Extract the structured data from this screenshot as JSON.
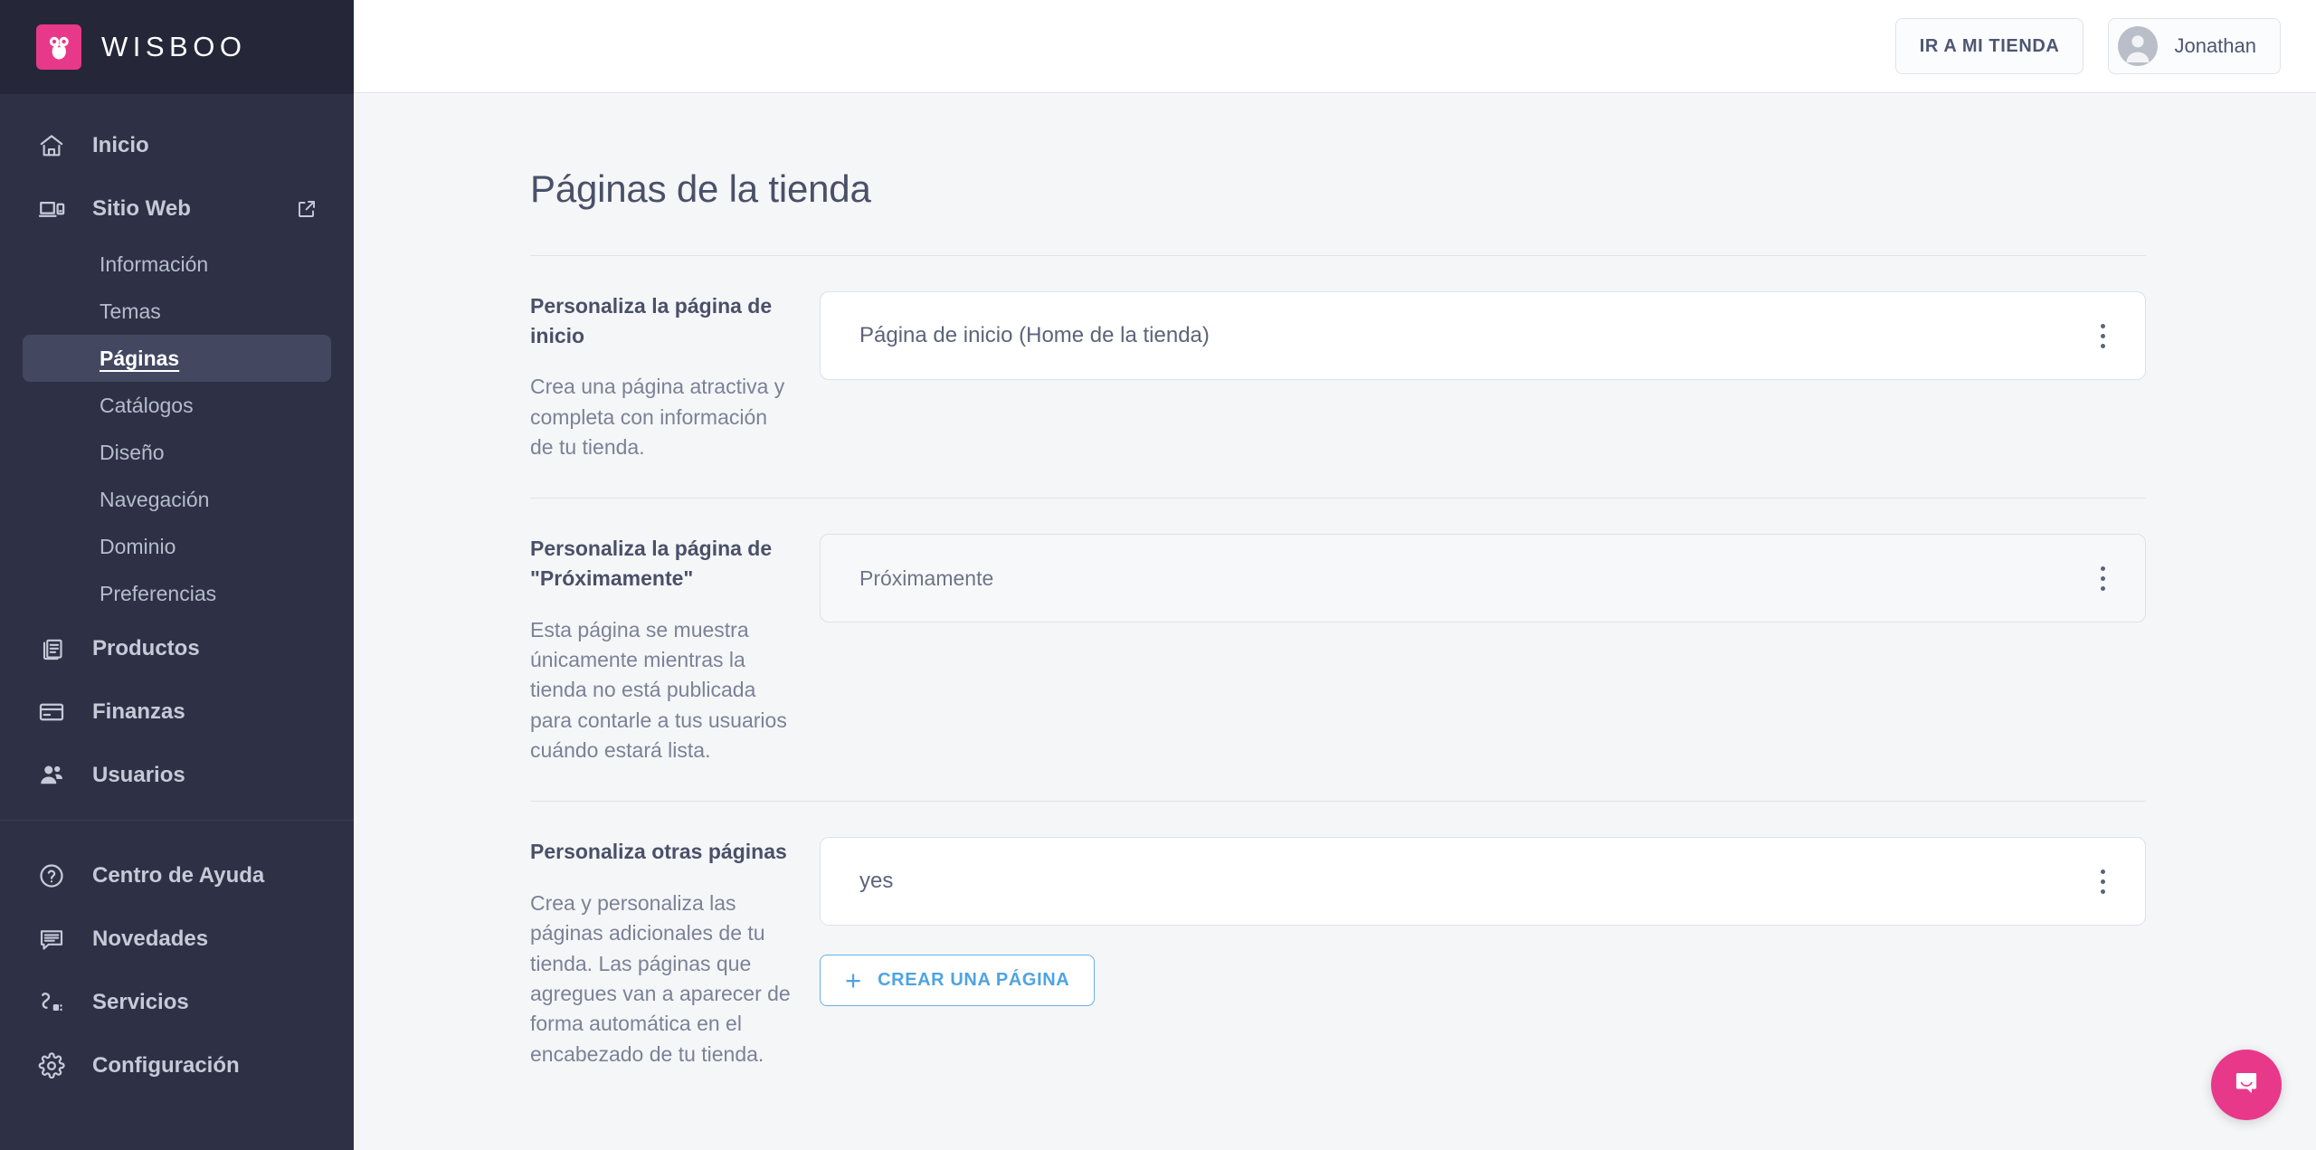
{
  "brand": {
    "name": "WISBOO",
    "logo_icon": "owl-icon",
    "logo_color": "#e8388a"
  },
  "sidebar": {
    "main_items": [
      {
        "label": "Inicio",
        "icon": "home-icon",
        "type": "item"
      },
      {
        "label": "Sitio Web",
        "icon": "monitor-icon",
        "type": "item",
        "external": true
      },
      {
        "label": "Información",
        "type": "sub"
      },
      {
        "label": "Temas",
        "type": "sub"
      },
      {
        "label": "Páginas",
        "type": "sub",
        "active": true
      },
      {
        "label": "Catálogos",
        "type": "sub"
      },
      {
        "label": "Diseño",
        "type": "sub"
      },
      {
        "label": "Navegación",
        "type": "sub"
      },
      {
        "label": "Dominio",
        "type": "sub"
      },
      {
        "label": "Preferencias",
        "type": "sub"
      },
      {
        "label": "Productos",
        "icon": "documents-icon",
        "type": "item"
      },
      {
        "label": "Finanzas",
        "icon": "card-icon",
        "type": "item"
      },
      {
        "label": "Usuarios",
        "icon": "users-icon",
        "type": "item"
      }
    ],
    "bottom_items": [
      {
        "label": "Centro de Ayuda",
        "icon": "help-circle-icon"
      },
      {
        "label": "Novedades",
        "icon": "chat-lines-icon"
      },
      {
        "label": "Servicios",
        "icon": "plug-icon"
      },
      {
        "label": "Configuración",
        "icon": "gear-icon"
      }
    ]
  },
  "topbar": {
    "store_button": "IR A MI TIENDA",
    "user_name": "Jonathan"
  },
  "main": {
    "title": "Páginas de la tienda",
    "sections": [
      {
        "title": "Personaliza la página de inicio",
        "description": "Crea una página atractiva y completa con información de tu tienda.",
        "card_label": "Página de inicio (Home de la tienda)",
        "card_style": "white"
      },
      {
        "title": "Personaliza la página de \"Próximamente\"",
        "description": "Esta página se muestra únicamente mientras la tienda no está publicada para contarle a tus usuarios cuándo estará lista.",
        "card_label": "Próximamente",
        "card_style": "muted"
      },
      {
        "title": "Personaliza otras páginas",
        "description": "Crea y personaliza las páginas adicionales de tu tienda. Las páginas que agregues van a aparecer de forma automática en el encabezado de tu tienda.",
        "card_label": "yes",
        "card_style": "white",
        "create_button": "CREAR UNA PÁGINA"
      }
    ]
  },
  "chat": {
    "icon": "chat-bubble-smile-icon",
    "color": "#e8388a"
  }
}
